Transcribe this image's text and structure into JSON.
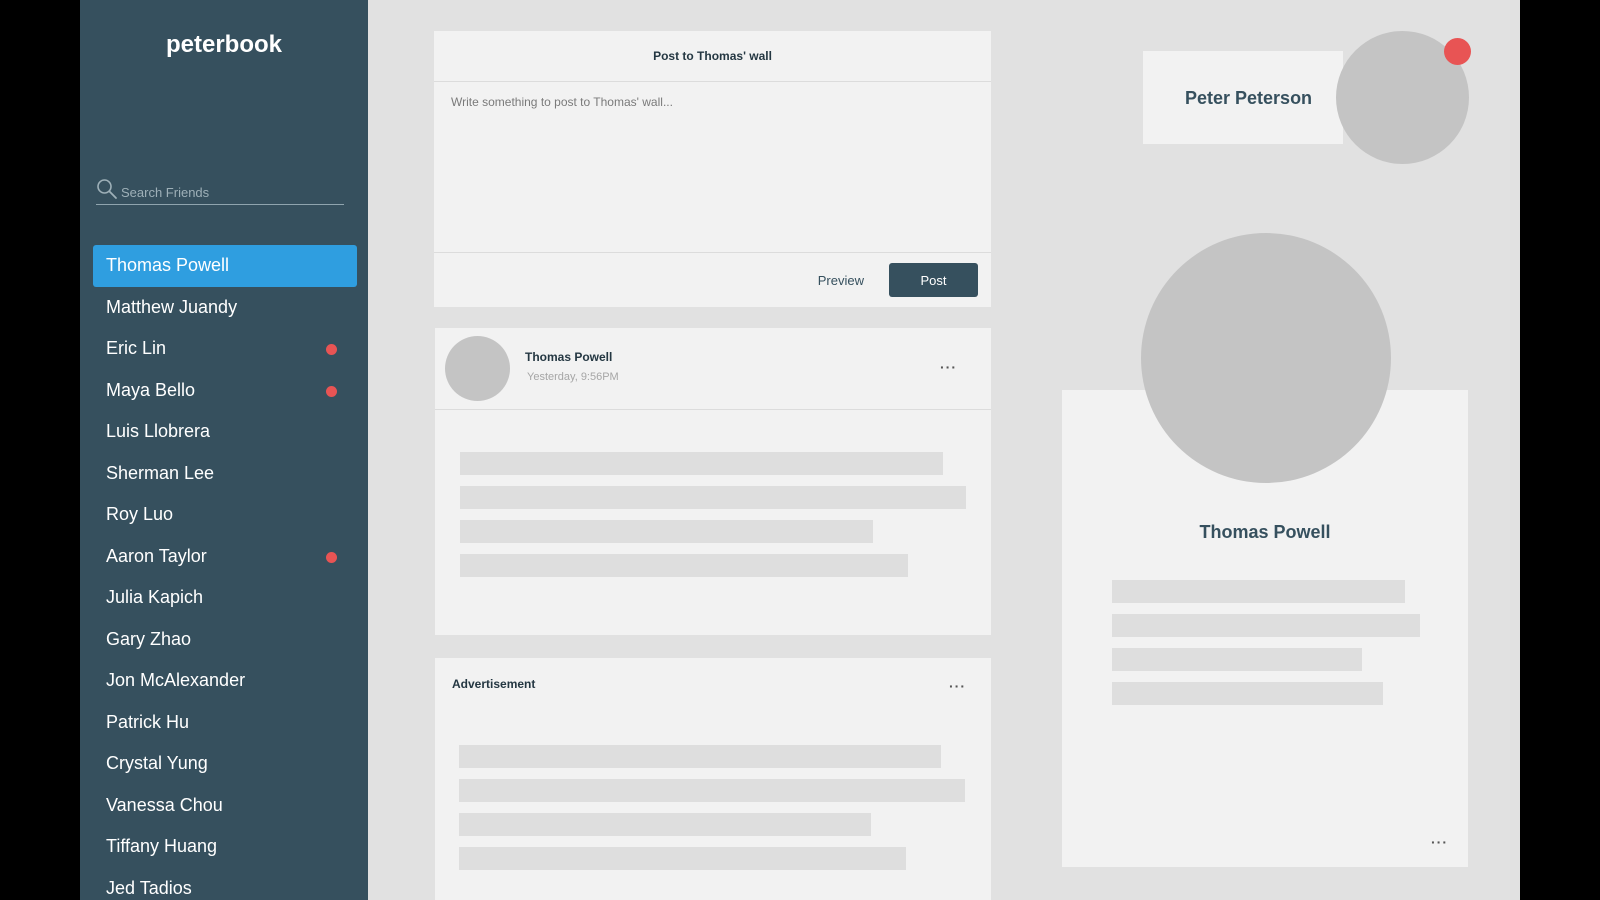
{
  "app": {
    "brand": "peterbook"
  },
  "search": {
    "placeholder": "Search Friends"
  },
  "friends": [
    {
      "name": "Thomas Powell",
      "active": true,
      "unread": false
    },
    {
      "name": "Matthew Juandy",
      "active": false,
      "unread": false
    },
    {
      "name": "Eric Lin",
      "active": false,
      "unread": true
    },
    {
      "name": "Maya Bello",
      "active": false,
      "unread": true
    },
    {
      "name": "Luis Llobrera",
      "active": false,
      "unread": false
    },
    {
      "name": "Sherman Lee",
      "active": false,
      "unread": false
    },
    {
      "name": "Roy Luo",
      "active": false,
      "unread": false
    },
    {
      "name": "Aaron Taylor",
      "active": false,
      "unread": true
    },
    {
      "name": "Julia Kapich",
      "active": false,
      "unread": false
    },
    {
      "name": "Gary Zhao",
      "active": false,
      "unread": false
    },
    {
      "name": "Jon McAlexander",
      "active": false,
      "unread": false
    },
    {
      "name": "Patrick Hu",
      "active": false,
      "unread": false
    },
    {
      "name": "Crystal Yung",
      "active": false,
      "unread": false
    },
    {
      "name": "Vanessa Chou",
      "active": false,
      "unread": false
    },
    {
      "name": "Tiffany Huang",
      "active": false,
      "unread": false
    },
    {
      "name": "Jed Tadios",
      "active": false,
      "unread": false
    }
  ],
  "composer": {
    "title": "Post to Thomas' wall",
    "placeholder": "Write something to post to Thomas' wall...",
    "preview_label": "Preview",
    "post_label": "Post"
  },
  "post": {
    "author": "Thomas Powell",
    "time": "Yesterday, 9:56PM",
    "more": "···"
  },
  "ad": {
    "title": "Advertisement",
    "more": "···"
  },
  "user": {
    "name": "Peter Peterson"
  },
  "profile": {
    "name": "Thomas Powell",
    "more": "···"
  },
  "colors": {
    "sidebar": "#36505e",
    "accent": "#2f9ee0",
    "notification": "#e85454",
    "background": "#e1e1e1",
    "card": "#f2f2f2"
  }
}
